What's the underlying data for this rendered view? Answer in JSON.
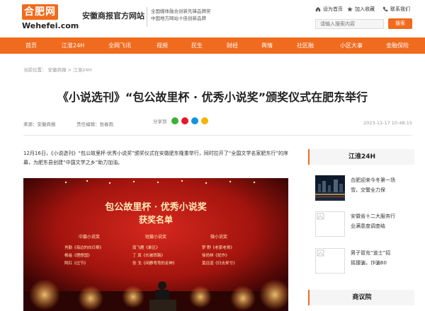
{
  "header": {
    "logo_text": "合肥网",
    "domain": "Wehefei.com",
    "site_name": "安徽商报官方网站",
    "slogan_line1": "全国媒体融合创新先锋品牌奖",
    "slogan_line2": "中国地方网站十佳创新品牌",
    "home_link": "设为首页",
    "fav_link": "加入收藏",
    "contact_link": "联系我们",
    "search_placeholder": "请输入搜索内容",
    "search_button": "搜索"
  },
  "nav": [
    "首页",
    "江淮24H",
    "全网飞讯",
    "视频",
    "民生",
    "财经",
    "舆情",
    "社区融",
    "小区大事",
    "金融保险"
  ],
  "breadcrumb": "当前位置： 安徽商报 > 江淮24H",
  "article": {
    "title": "《小说选刊》“包公故里杯 · 优秀小说奖”颁奖仪式在肥东举行",
    "source": "来源：安徽商报",
    "editor": "责任编辑：张春雨",
    "share_label": "分享到",
    "datetime": "2023-12-17 10:48:15",
    "paragraph": "12月16日，《小说选刊》“包公故里杯·优秀小说奖”颁奖仪式在安徽肥东隆重举行，同时拉开了“全国文学名家肥东行”的序幕，为肥东县创建“中国文学之乡”助力加油。"
  },
  "photo": {
    "banner_line1": "包公故里杯 · 优秀小说奖",
    "banner_line2": "获奖名单",
    "col_zhong": "中篇小说奖",
    "col_duan": "短篇小说奖",
    "col_wei": "微小说奖",
    "zhong_names": [
      "肖勤《海边的向日葵》",
      "杨遥《理想国》",
      "阿红《过节》"
    ],
    "duan_names": [
      "南飞雁《乘区》",
      "丁 真《长被西路》",
      "张 戈《闲静弯弯的走神》"
    ],
    "wei_names": [
      "梦 野《老家老哥》",
      "徐尚林《犹作》",
      "莫远道《归去来兮》"
    ]
  },
  "sidebar": {
    "section1_title": "江淮24H",
    "items": [
      {
        "line1": "合肥迎来今冬第一场",
        "line2": "雪，交警全力保"
      },
      {
        "line1": "安徽省十二大服务行",
        "line2": "业满意度调查结"
      },
      {
        "line1": "男子冒充“道士”招",
        "line2": "摇撞骗，诈骗60"
      }
    ],
    "section2_title": "商议院"
  },
  "colors": {
    "accent": "#f06b1d",
    "share_wechat": "#3cb034",
    "share_weibo": "#e6162d",
    "share_qq": "#1296db",
    "share_qzone": "#f5b400"
  },
  "icons": [
    "home-icon",
    "star-icon",
    "phone-icon",
    "wechat-icon",
    "weibo-icon",
    "qq-icon",
    "qzone-icon"
  ]
}
